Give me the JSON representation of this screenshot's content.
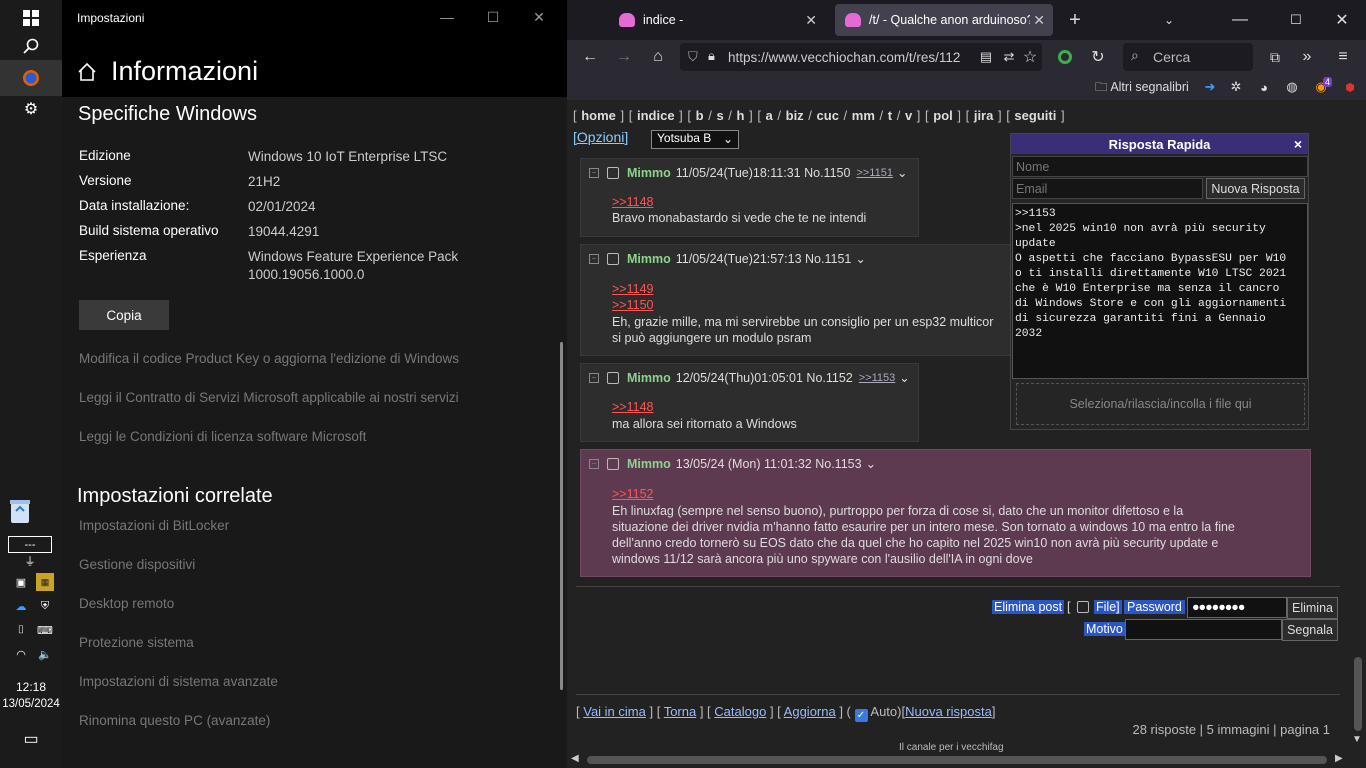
{
  "taskbar": {
    "clock": "12:18",
    "date": "13/05/2024",
    "battery": "---"
  },
  "settings": {
    "window_title": "Impostazioni",
    "header": "Informazioni",
    "section1": "Specifiche Windows",
    "specs": [
      {
        "label": "Edizione",
        "value": "Windows 10 IoT Enterprise LTSC"
      },
      {
        "label": "Versione",
        "value": "21H2"
      },
      {
        "label": "Data installazione:",
        "value": "02/01/2024"
      },
      {
        "label": "Build sistema operativo",
        "value": "19044.4291"
      },
      {
        "label": "Esperienza",
        "value": "Windows Feature Experience Pack 1000.19056.1000.0"
      }
    ],
    "copy_button": "Copia",
    "links": [
      "Modifica il codice Product Key o aggiorna l'edizione di Windows",
      "Leggi il Contratto di Servizi Microsoft applicabile ai nostri servizi",
      "Leggi le Condizioni di licenza software Microsoft"
    ],
    "section2": "Impostazioni correlate",
    "related": [
      "Impostazioni di BitLocker",
      "Gestione dispositivi",
      "Desktop remoto",
      "Protezione sistema",
      "Impostazioni di sistema avanzate",
      "Rinomina questo PC (avanzate)"
    ]
  },
  "browser": {
    "tabs": [
      {
        "title": "indice -"
      },
      {
        "title": "/t/ - Qualche anon arduinoso? S"
      }
    ],
    "url": "https://www.vecchiochan.com/t/res/112",
    "search_placeholder": "Cerca",
    "bookmarks_label": "Altri segnalibri",
    "notif_badge": "4"
  },
  "board": {
    "nav": [
      {
        "b": "[",
        "items": [
          "home"
        ],
        "e": "]"
      },
      {
        "b": "[",
        "items": [
          "indice"
        ],
        "e": "]"
      },
      {
        "b": "[",
        "items": [
          "b",
          "s",
          "h"
        ],
        "e": "]"
      },
      {
        "b": "[",
        "items": [
          "a",
          "biz",
          "cuc",
          "mm",
          "t",
          "v"
        ],
        "e": "]"
      },
      {
        "b": "[",
        "items": [
          "pol"
        ],
        "e": "]"
      },
      {
        "b": "[",
        "items": [
          "jira"
        ],
        "e": "]"
      },
      {
        "b": "[",
        "items": [
          "seguiti"
        ],
        "e": "]"
      }
    ],
    "options": "[Opzioni]",
    "style": "Yotsuba B",
    "posts": [
      {
        "name": "Mimmo",
        "date": "11/05/24(Tue)18:11:31",
        "no": "No.1150",
        "backlinks": ">>1151",
        "quotes": [
          ">>1148"
        ],
        "text": [
          "Bravo monabastardo si vede che te ne intendi"
        ]
      },
      {
        "name": "Mimmo",
        "date": "11/05/24(Tue)21:57:13",
        "no": "No.1151",
        "backlinks": "",
        "quotes": [
          ">>1149",
          ">>1150"
        ],
        "text": [
          "Eh, grazie mille, ma mi servirebbe un consiglio per un esp32 multicor",
          "si può aggiungere un modulo psram"
        ]
      },
      {
        "name": "Mimmo",
        "date": "12/05/24(Thu)01:05:01",
        "no": "No.1152",
        "backlinks": ">>1153",
        "quotes": [
          ">>1148"
        ],
        "text": [
          "ma allora sei ritornato a Windows"
        ]
      },
      {
        "name": "Mimmo",
        "date": "13/05/24 (Mon) 11:01:32",
        "no": "No.1153",
        "backlinks": "",
        "quotes": [
          ">>1152"
        ],
        "text": [
          "Eh linuxfag (sempre nel senso buono), purtroppo per forza di cose si, dato che un monitor difettoso e la",
          "situazione dei driver nvidia m'hanno fatto esaurire per un intero mese. Son tornato a windows 10 ma entro la fine",
          "dell'anno credo tornerò su EOS dato che da quel che ho capito nel 2025 win10 non avrà più security update e",
          "windows 11/12 sarà ancora più uno spyware con l'ausilio dell'IA in ogni dove"
        ]
      }
    ],
    "quick_reply": {
      "title": "Risposta Rapida",
      "close": "×",
      "name_ph": "Nome",
      "email_ph": "Email",
      "submit": "Nuova Risposta",
      "message": ">>1153\n>nel 2025 win10 non avrà più security\nupdate\nO aspetti che facciano BypassESU per W10\no ti installi direttamente W10 LTSC 2021\nche è W10 Enterprise ma senza il cancro\ndi Windows Store e con gli aggiornamenti\ndi sicurezza garantiti fini a Gennaio\n2032",
      "drop": "Seleziona/rilascia/incolla i file qui"
    },
    "delete": {
      "label": "Elimina post",
      "bracket": "[",
      "file_label": "File]",
      "password_label": "Password",
      "password": "●●●●●●●●",
      "delete_btn": "Elimina",
      "reason_label": "Motivo",
      "report_btn": "Segnala"
    },
    "footer": {
      "top": "Vai in cima",
      "back": "Torna",
      "catalog": "Catalogo",
      "refresh": "Aggiorna",
      "auto": "Auto",
      "new_reply": "Nuova risposta",
      "stats": "28 risposte | 5 immagini | pagina 1",
      "tagline": "Il canale per i vecchifag"
    }
  }
}
